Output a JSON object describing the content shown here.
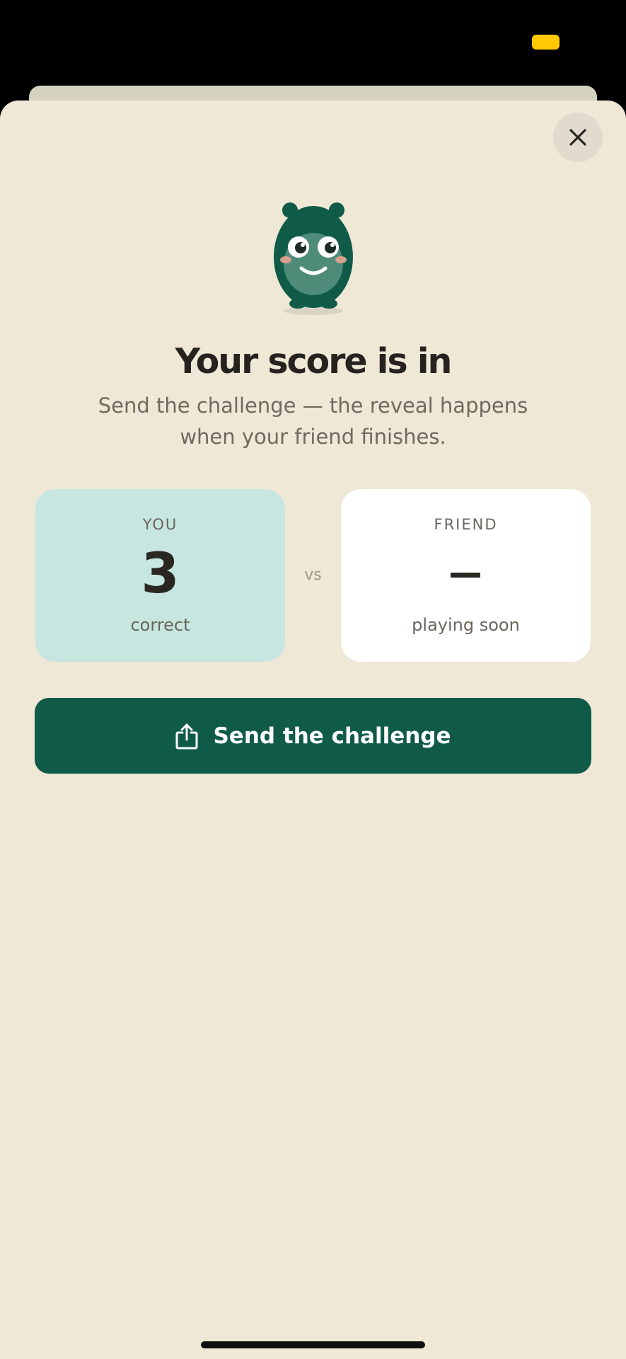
{
  "colors": {
    "background": "#efe8d7",
    "accent_green": "#0f5b48",
    "you_card": "#c6e6df",
    "friend_card": "#ffffff",
    "status_indicator": "#ffc800"
  },
  "status_bar": {
    "indicator_icon": "battery-indicator-icon"
  },
  "header": {
    "close_icon": "close-icon"
  },
  "mascot": {
    "icon": "mascot-character-icon"
  },
  "title": "Your score is in",
  "subtitle": "Send the challenge — the reveal happens when your friend finishes.",
  "scores": {
    "you": {
      "label": "YOU",
      "value": "3",
      "caption": "correct"
    },
    "vs": "vs",
    "friend": {
      "label": "FRIEND",
      "value": "–",
      "caption": "playing soon"
    }
  },
  "send_button": {
    "icon": "share-icon",
    "label": "Send the challenge"
  }
}
